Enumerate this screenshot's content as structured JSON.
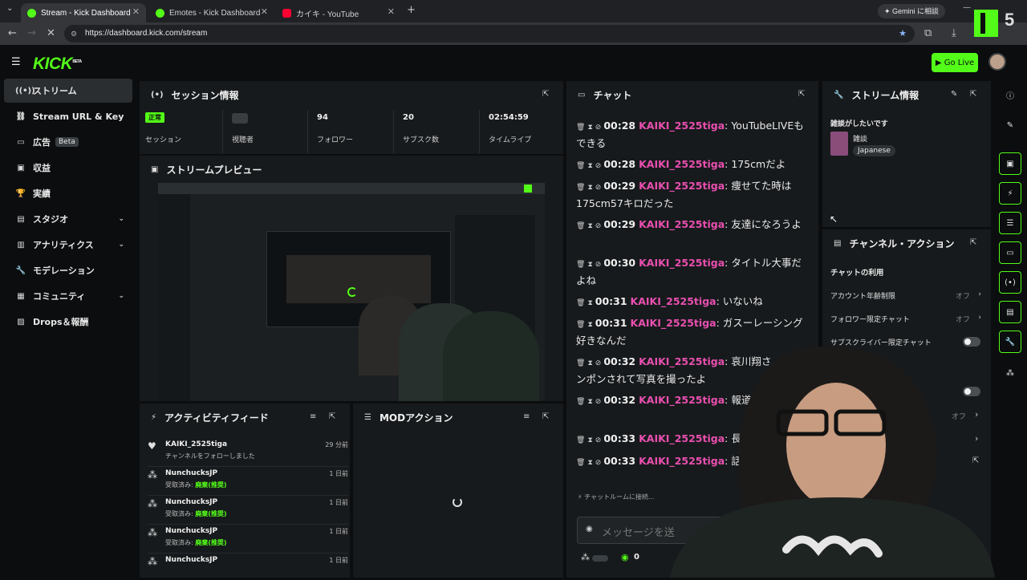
{
  "browser": {
    "tabs": [
      {
        "title": "Stream - Kick Dashboard",
        "active": true
      },
      {
        "title": "Emotes - Kick Dashboard",
        "active": false
      },
      {
        "title": "カイキ - YouTube",
        "active": false
      }
    ],
    "url": "https://dashboard.kick.com/stream",
    "gemini_label": "Gemini に相談"
  },
  "header": {
    "logo": "KICK",
    "logo_badge": "BETA",
    "go_live": "Go Live"
  },
  "sidebar": {
    "items": [
      {
        "label": "ストリーム",
        "icon": "broadcast-icon",
        "active": true
      },
      {
        "label": "Stream URL & Key",
        "icon": "link-icon"
      },
      {
        "label": "広告",
        "icon": "ad-icon",
        "badge": "Beta"
      },
      {
        "label": "収益",
        "icon": "wallet-icon"
      },
      {
        "label": "実績",
        "icon": "trophy-icon"
      },
      {
        "label": "スタジオ",
        "icon": "studio-icon",
        "expandable": true
      },
      {
        "label": "アナリティクス",
        "icon": "chart-icon",
        "expandable": true
      },
      {
        "label": "モデレーション",
        "icon": "wrench-icon"
      },
      {
        "label": "コミュニティ",
        "icon": "community-icon",
        "expandable": true
      },
      {
        "label": "Drops＆報酬",
        "icon": "gift-icon"
      }
    ]
  },
  "session": {
    "title": "セッション情報",
    "stats": [
      {
        "value": "正常",
        "label": "セッション"
      },
      {
        "value": "",
        "label": "視聴者"
      },
      {
        "value": "94",
        "label": "フォロワー"
      },
      {
        "value": "20",
        "label": "サブスク数"
      },
      {
        "value": "02:54:59",
        "label": "タイムライブ"
      }
    ]
  },
  "preview": {
    "title": "ストリームプレビュー"
  },
  "activity": {
    "title": "アクティビティフィード",
    "items": [
      {
        "name": "KAIKI_2525tiga",
        "sub": "チャンネルをフォローしました",
        "time": "29 分前",
        "icon": "heart-icon"
      },
      {
        "name": "NunchucksJP",
        "sub_prefix": "受取済み:",
        "reward": "廃棄(推奨)",
        "time": "1 日前",
        "icon": "reward-icon"
      },
      {
        "name": "NunchucksJP",
        "sub_prefix": "受取済み:",
        "reward": "廃棄(推奨)",
        "time": "1 日前",
        "icon": "reward-icon"
      },
      {
        "name": "NunchucksJP",
        "sub_prefix": "受取済み:",
        "reward": "廃棄(推奨)",
        "time": "1 日前",
        "icon": "reward-icon"
      },
      {
        "name": "NunchucksJP",
        "sub_prefix": "",
        "reward": "",
        "time": "1 日前",
        "icon": "reward-icon"
      }
    ]
  },
  "mod": {
    "title": "MODアクション"
  },
  "chat": {
    "title": "チャット",
    "messages": [
      {
        "time": "00:28",
        "user": "KAIKI_2525tiga",
        "text": "YouTubeLIVEもできる"
      },
      {
        "time": "00:28",
        "user": "KAIKI_2525tiga",
        "text": "175cmだよ"
      },
      {
        "time": "00:29",
        "user": "KAIKI_2525tiga",
        "text": "痩せてた時は175cm57キロだった"
      },
      {
        "time": "00:29",
        "user": "KAIKI_2525tiga",
        "text": "友達になろうよ"
      },
      {
        "time": "00:30",
        "user": "KAIKI_2525tiga",
        "text": "タイトル大事だよね"
      },
      {
        "time": "00:31",
        "user": "KAIKI_2525tiga",
        "text": "いないね"
      },
      {
        "time": "00:31",
        "user": "KAIKI_2525tiga",
        "text": "ガスーレーシング好きなんだ"
      },
      {
        "time": "00:32",
        "user": "KAIKI_2525tiga",
        "text": "哀川翔さ…肩ポンポンされて写真を撮ったよ"
      },
      {
        "time": "00:32",
        "user": "KAIKI_2525tiga",
        "text": "報道…ョン"
      },
      {
        "time": "00:33",
        "user": "KAIKI_2525tiga",
        "text": "長野県…"
      },
      {
        "time": "00:33",
        "user": "KAIKI_2525tiga",
        "text": "話をし…い"
      }
    ],
    "connecting": "チャットルームに接続...",
    "input_placeholder": "メッセージを送",
    "count": "0"
  },
  "stream_info": {
    "title": "ストリーム情報",
    "stream_title": "雑談がしたいです",
    "category": "雑談",
    "tag": "Japanese"
  },
  "channel_actions": {
    "title": "チャンネル・アクション",
    "section": "チャットの利用",
    "rows": [
      {
        "label": "アカウント年齢制限",
        "state": "オフ"
      },
      {
        "label": "フォロワー限定チャット",
        "state": "オフ"
      },
      {
        "label": "サブスクライバー限定チャット",
        "state": ""
      }
    ],
    "extra_state": "オフ"
  },
  "overlay": {
    "counter": "5"
  }
}
